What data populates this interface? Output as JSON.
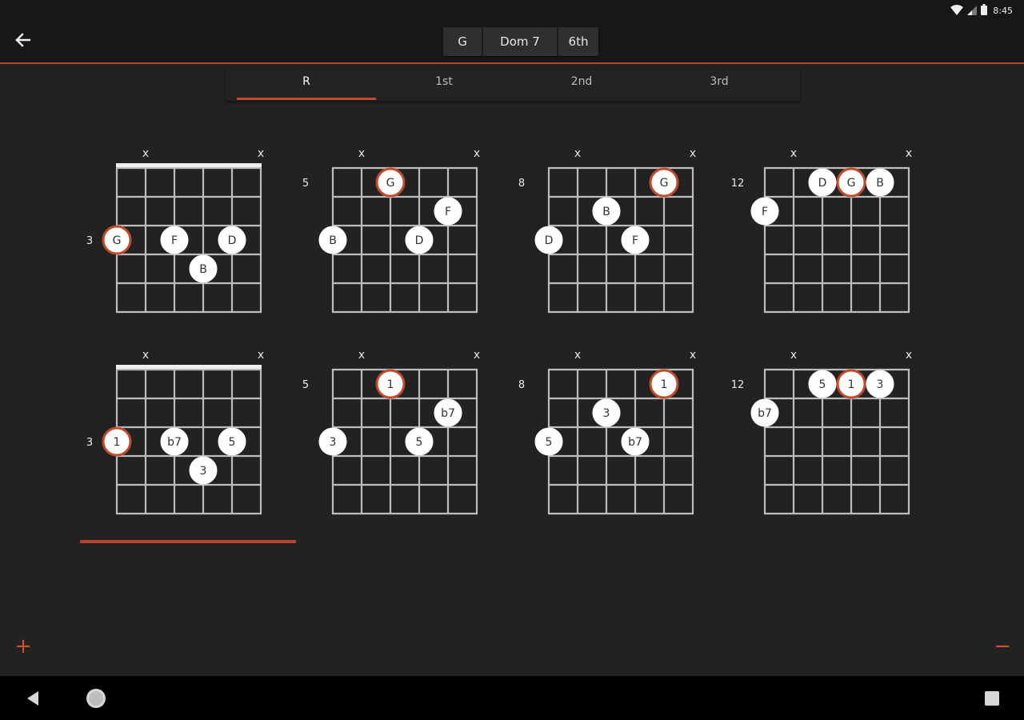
{
  "status": {
    "time": "8:45"
  },
  "chord_selector": {
    "root": "G",
    "quality": "Dom 7",
    "string_set": "6th"
  },
  "tabs": [
    {
      "label": "R",
      "active": true
    },
    {
      "label": "1st",
      "active": false
    },
    {
      "label": "2nd",
      "active": false
    },
    {
      "label": "3rd",
      "active": false
    }
  ],
  "colors": {
    "accent": "#c24a2b",
    "background": "#222222",
    "grid": "#bdbdbd"
  },
  "icons": {
    "back": "arrow-left-icon",
    "add": "plus-icon",
    "remove": "minus-icon",
    "nav_back": "triangle-back-icon",
    "nav_home": "circle-home-icon",
    "nav_recents": "square-recents-icon"
  },
  "bottom": {
    "add_label": "+",
    "remove_label": "−"
  },
  "diagrams": [
    {
      "mode": "notes",
      "fret_label": "3",
      "nut": true,
      "muted": [
        2,
        6
      ],
      "dots": [
        {
          "string": 1,
          "fret": 3,
          "text": "G",
          "root": true
        },
        {
          "string": 3,
          "fret": 3,
          "text": "F",
          "root": false
        },
        {
          "string": 4,
          "fret": 4,
          "text": "B",
          "root": false
        },
        {
          "string": 5,
          "fret": 3,
          "text": "D",
          "root": false
        }
      ]
    },
    {
      "mode": "notes",
      "fret_label": "5",
      "nut": false,
      "muted": [
        2,
        6
      ],
      "dots": [
        {
          "string": 1,
          "fret": 3,
          "text": "B",
          "root": false
        },
        {
          "string": 3,
          "fret": 1,
          "text": "G",
          "root": true
        },
        {
          "string": 4,
          "fret": 3,
          "text": "D",
          "root": false
        },
        {
          "string": 5,
          "fret": 2,
          "text": "F",
          "root": false
        }
      ]
    },
    {
      "mode": "notes",
      "fret_label": "8",
      "nut": false,
      "muted": [
        2,
        6
      ],
      "dots": [
        {
          "string": 1,
          "fret": 3,
          "text": "D",
          "root": false
        },
        {
          "string": 3,
          "fret": 2,
          "text": "B",
          "root": false
        },
        {
          "string": 4,
          "fret": 3,
          "text": "F",
          "root": false
        },
        {
          "string": 5,
          "fret": 1,
          "text": "G",
          "root": true
        }
      ]
    },
    {
      "mode": "notes",
      "fret_label": "12",
      "nut": false,
      "muted": [
        2,
        6
      ],
      "dots": [
        {
          "string": 1,
          "fret": 2,
          "text": "F",
          "root": false
        },
        {
          "string": 3,
          "fret": 1,
          "text": "D",
          "root": false
        },
        {
          "string": 4,
          "fret": 1,
          "text": "G",
          "root": true
        },
        {
          "string": 5,
          "fret": 1,
          "text": "B",
          "root": false
        }
      ]
    },
    {
      "mode": "intervals",
      "fret_label": "3",
      "nut": true,
      "muted": [
        2,
        6
      ],
      "dots": [
        {
          "string": 1,
          "fret": 3,
          "text": "1",
          "root": true
        },
        {
          "string": 3,
          "fret": 3,
          "text": "b7",
          "root": false
        },
        {
          "string": 4,
          "fret": 4,
          "text": "3",
          "root": false
        },
        {
          "string": 5,
          "fret": 3,
          "text": "5",
          "root": false
        }
      ]
    },
    {
      "mode": "intervals",
      "fret_label": "5",
      "nut": false,
      "muted": [
        2,
        6
      ],
      "dots": [
        {
          "string": 1,
          "fret": 3,
          "text": "3",
          "root": false
        },
        {
          "string": 3,
          "fret": 1,
          "text": "1",
          "root": true
        },
        {
          "string": 4,
          "fret": 3,
          "text": "5",
          "root": false
        },
        {
          "string": 5,
          "fret": 2,
          "text": "b7",
          "root": false
        }
      ]
    },
    {
      "mode": "intervals",
      "fret_label": "8",
      "nut": false,
      "muted": [
        2,
        6
      ],
      "dots": [
        {
          "string": 1,
          "fret": 3,
          "text": "5",
          "root": false
        },
        {
          "string": 3,
          "fret": 2,
          "text": "3",
          "root": false
        },
        {
          "string": 4,
          "fret": 3,
          "text": "b7",
          "root": false
        },
        {
          "string": 5,
          "fret": 1,
          "text": "1",
          "root": true
        }
      ]
    },
    {
      "mode": "intervals",
      "fret_label": "12",
      "nut": false,
      "muted": [
        2,
        6
      ],
      "dots": [
        {
          "string": 1,
          "fret": 2,
          "text": "b7",
          "root": false
        },
        {
          "string": 3,
          "fret": 1,
          "text": "5",
          "root": false
        },
        {
          "string": 4,
          "fret": 1,
          "text": "1",
          "root": true
        },
        {
          "string": 5,
          "fret": 1,
          "text": "3",
          "root": false
        }
      ]
    }
  ],
  "muted_symbol": "x"
}
